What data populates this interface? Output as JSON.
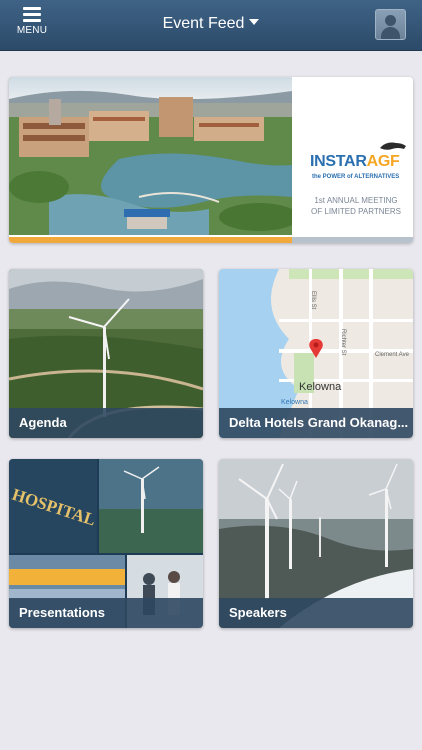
{
  "header": {
    "menu_label": "MENU",
    "title": "Event Feed"
  },
  "banner": {
    "logo_part1": "INSTAR",
    "logo_part2": "AGF",
    "tagline": "the POWER of ALTERNATIVES",
    "meeting_line1": "1st ANNUAL MEETING",
    "meeting_line2": "OF LIMITED PARTNERS",
    "slide_progress": 0.7
  },
  "tiles": [
    {
      "label": "Agenda"
    },
    {
      "label": "Delta Hotels Grand Okanag..."
    },
    {
      "label": "Presentations"
    },
    {
      "label": "Speakers"
    }
  ],
  "map": {
    "city": "Kelowna",
    "small_label": "Kelowna",
    "street1": "Clement Ave",
    "street2": "Richter St",
    "street3": "Ellis St"
  },
  "presentations_image": {
    "sign_text": "HOSPITAL"
  },
  "colors": {
    "header": "#34567a",
    "caption_bar": "#2f4860",
    "accent": "#f2a93b",
    "map_water": "#a7d1f1"
  }
}
